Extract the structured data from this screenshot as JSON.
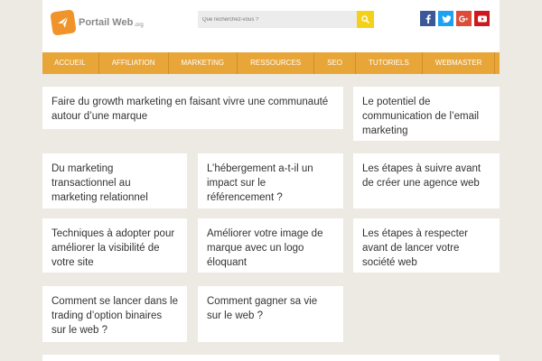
{
  "header": {
    "logo_text": "Portail Web",
    "logo_tld": ".org",
    "search_placeholder": "Que recherchez-vous ?"
  },
  "social": [
    "facebook-icon",
    "twitter-icon",
    "google-plus-icon",
    "youtube-icon"
  ],
  "colors": {
    "accent": "#e8a638",
    "search_button": "#f2d118",
    "background": "#ede9e3"
  },
  "nav": {
    "items": [
      "ACCUEIL",
      "AFFILIATION",
      "MARKETING",
      "RESSOURCES",
      "SEO",
      "TUTORIELS",
      "WEBMASTER"
    ]
  },
  "articles": [
    {
      "title": "Faire du growth marketing en faisant vivre une communauté autour d’une marque"
    },
    {
      "title": "Le potentiel de communication de l’email marketing"
    },
    {
      "title": "Du marketing transactionnel au marketing relationnel"
    },
    {
      "title": "L’hébergement a-t-il un impact sur le référencement ?"
    },
    {
      "title": "Les étapes à suivre avant de créer une agence web"
    },
    {
      "title": "Techniques à adopter pour améliorer la visibilité de votre site"
    },
    {
      "title": "Améliorer votre image de marque avec un logo éloquant"
    },
    {
      "title": "Les étapes à respecter avant de lancer votre société web"
    },
    {
      "title": "Comment se lancer dans le trading d’option binaires sur le web ?"
    },
    {
      "title": "Comment gagner sa vie sur le web ?"
    }
  ]
}
